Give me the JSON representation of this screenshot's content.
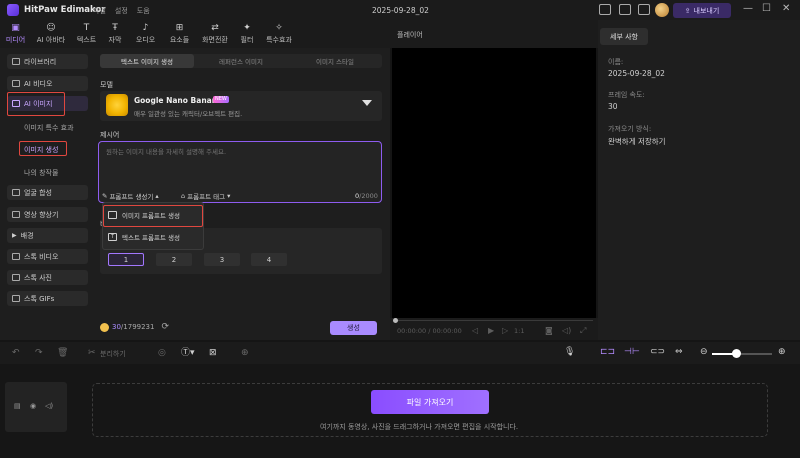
{
  "app": {
    "title": "HitPaw Edimakor",
    "menu": [
      "파일",
      "설정",
      "도움"
    ],
    "document_title": "2025-09-28_02",
    "export_label": "내보내기",
    "accent": "#a377ff"
  },
  "toolbar": {
    "tabs": [
      {
        "label": "미디어",
        "icon": "media-icon"
      },
      {
        "label": "AI 아바타",
        "icon": "avatar-icon"
      },
      {
        "label": "텍스트",
        "icon": "text-icon"
      },
      {
        "label": "자막",
        "icon": "subtitle-icon"
      },
      {
        "label": "오디오",
        "icon": "audio-icon"
      },
      {
        "label": "요소들",
        "icon": "elements-icon"
      },
      {
        "label": "화면전환",
        "icon": "transition-icon"
      },
      {
        "label": "필터",
        "icon": "filter-icon"
      },
      {
        "label": "특수효과",
        "icon": "effects-icon"
      }
    ],
    "active_tab": "미디어"
  },
  "sidebar": {
    "items": [
      {
        "label": "라이브러리"
      },
      {
        "label": "AI 비디오"
      },
      {
        "label": "AI 이미지"
      },
      {
        "label": "얼굴 합성"
      },
      {
        "label": "영상 향상기"
      },
      {
        "label": "배경"
      },
      {
        "label": "스톡 비디오"
      },
      {
        "label": "스톡 사진"
      },
      {
        "label": "스톡 GIFs"
      }
    ],
    "sub_items": [
      "이미지 특수 효과",
      "이미지 생성",
      "나의 창작물"
    ]
  },
  "generator": {
    "subtabs": [
      "텍스트 이미지 생성",
      "레퍼런스 이미지",
      "이미지 스타일"
    ],
    "model_label": "모델",
    "model_name": "Google Nano Banana",
    "model_badge": "NEW",
    "model_desc": "매우 일관성 있는 캐릭터/오브젝트 편집.",
    "prompt_label": "제시어",
    "prompt_placeholder": "원하는 이미지 내용을 자세히 설명해 주세요.",
    "prompt_gen_label": "프롬프트 생성기",
    "prompt_tag_label": "프롬프트 태그",
    "char_count": "0",
    "char_max": "/2000",
    "dropdown": [
      "이미지 프롬프트 생성",
      "텍스트 프롬프트 생성"
    ],
    "ratio_label": "비",
    "ratios": [
      "1",
      "2",
      "3",
      "4"
    ],
    "selected_ratio": "1",
    "credits": "30",
    "credits_total": "/1799231",
    "generate_label": "생성"
  },
  "player": {
    "title": "플레이어",
    "time_current": "00:00:00",
    "time_total": "00:00:00",
    "speed": "1:1"
  },
  "info": {
    "tab": "세부 사항",
    "fields": [
      {
        "label": "이름:",
        "value": "2025-09-28_02"
      },
      {
        "label": "프레임 속도:",
        "value": "30"
      },
      {
        "label": "가져오기 방식:",
        "value": "완벽하게 저장하기"
      }
    ]
  },
  "timeline": {
    "split_label": "분리하기",
    "import_label": "파일 가져오기",
    "drop_text": "여기까지 동영상, 사진을 드래그하거나 가져오면 편집을 시작합니다."
  }
}
